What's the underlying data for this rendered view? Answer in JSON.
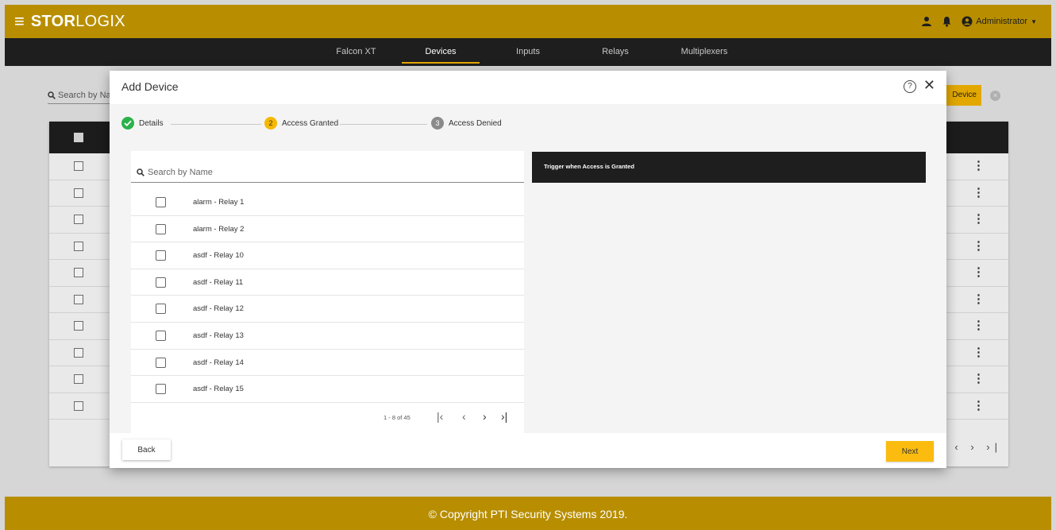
{
  "header": {
    "logo_bold": "STOR",
    "logo_light": "LOGIX",
    "user_label": "Administrator",
    "icons": [
      "menu-icon",
      "person-icon",
      "bell-icon",
      "account-circle-icon",
      "caret-down-icon"
    ]
  },
  "nav": {
    "tabs": [
      {
        "label": "Falcon XT",
        "active": false
      },
      {
        "label": "Devices",
        "active": true
      },
      {
        "label": "Inputs",
        "active": false
      },
      {
        "label": "Relays",
        "active": false
      },
      {
        "label": "Multiplexers",
        "active": false
      }
    ]
  },
  "background_page": {
    "search_placeholder": "Search by Na",
    "add_button_label": "Device"
  },
  "modal": {
    "title": "Add Device",
    "steps": [
      {
        "number": "1",
        "label": "Details",
        "state": "done"
      },
      {
        "number": "2",
        "label": "Access Granted",
        "state": "current"
      },
      {
        "number": "3",
        "label": "Access Denied",
        "state": "pending"
      }
    ],
    "search_placeholder": "Search by Name",
    "relays": [
      {
        "label": "alarm - Relay 1",
        "checked": false
      },
      {
        "label": "alarm - Relay 2",
        "checked": false
      },
      {
        "label": "asdf - Relay 10",
        "checked": false
      },
      {
        "label": "asdf - Relay 11",
        "checked": false
      },
      {
        "label": "asdf - Relay 12",
        "checked": false
      },
      {
        "label": "asdf - Relay 13",
        "checked": false
      },
      {
        "label": "asdf - Relay 14",
        "checked": false
      },
      {
        "label": "asdf - Relay 15",
        "checked": false
      }
    ],
    "pagination": {
      "range": "1 - 8 of 45"
    },
    "trigger_heading": "Trigger when Access is Granted",
    "back_label": "Back",
    "next_label": "Next"
  },
  "footer": {
    "copyright": "© Copyright PTI Security Systems 2019."
  },
  "colors": {
    "brand_gold": "#b88e00",
    "accent_yellow": "#fbbc0f",
    "nav_dark": "#1e1e1e",
    "step_done": "#2ab24a",
    "step_current": "#f6b800",
    "step_pending": "#8a8a8a"
  }
}
